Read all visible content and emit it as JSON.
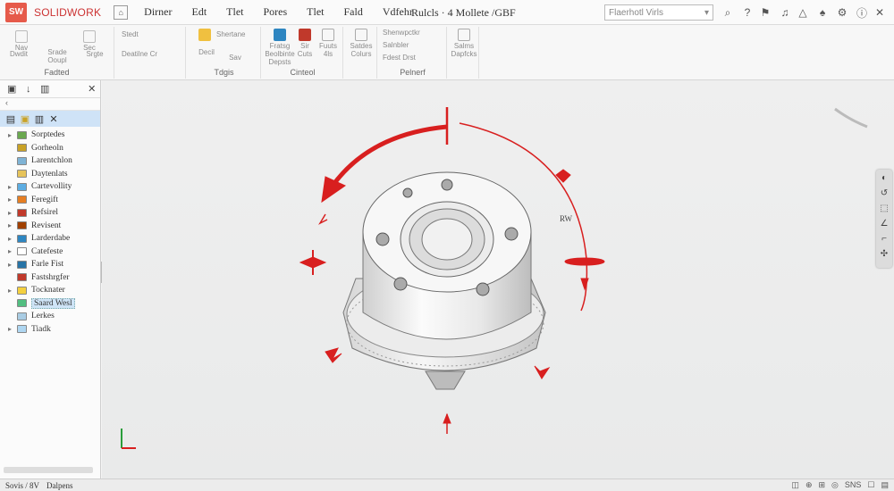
{
  "app": {
    "logo": "SW",
    "brand": "SOLIDWORK",
    "home_icon": "home-icon",
    "menus": [
      "Dirner",
      "Edt",
      "Tlet",
      "Pores",
      "Tlet",
      "Fald",
      "Vdfehr"
    ],
    "doc_title": "Rulcls · 4 Mollete /GBF",
    "search_placeholder": "Flaerhotl Virls"
  },
  "ribbon": {
    "groups": [
      {
        "label": "Fadted",
        "buttons": [
          "Nav",
          "Sec",
          "Dwdit",
          "Srade Ooupl",
          "Srgte"
        ]
      },
      {
        "label": "",
        "buttons": [
          "Stedt",
          "Deatilne Cr"
        ]
      },
      {
        "label": "Tdgis",
        "buttons": [
          "Shertane",
          "Decil",
          "Sav"
        ]
      },
      {
        "label": "Cinteol",
        "buttons": [
          "Fratsg Beolbinte Depsts",
          "Sir Cuts",
          "Fuuts 4ls"
        ]
      },
      {
        "label": "",
        "buttons": [
          "Satdes Colurs"
        ]
      },
      {
        "label": "Pelnerf",
        "buttons": [
          "Shenwpctkr",
          "Salnbler",
          "Fdest Drst"
        ]
      },
      {
        "label": "",
        "buttons": [
          "Salms Dapfcks"
        ]
      }
    ]
  },
  "feature_tree": {
    "tabs": [
      "▣",
      "↓",
      "▥",
      "✕"
    ],
    "filter": "‹",
    "nodes": [
      {
        "label": "Sorptedes",
        "color": "#6aa84f",
        "expander": "▸"
      },
      {
        "label": "Gorheoln",
        "color": "#c9a227",
        "expander": ""
      },
      {
        "label": "Larentchlon",
        "color": "#7fb3d5",
        "expander": ""
      },
      {
        "label": "Daytenlats",
        "color": "#e6c35a",
        "expander": ""
      },
      {
        "label": "Cartevollity",
        "color": "#5dade2",
        "expander": "▸"
      },
      {
        "label": "Feregift",
        "color": "#e67e22",
        "expander": "▸"
      },
      {
        "label": "Refsirel",
        "color": "#c0392b",
        "expander": "▸"
      },
      {
        "label": "Revisent",
        "color": "#a04000",
        "expander": "▸"
      },
      {
        "label": "Larderdabe",
        "color": "#2e86c1",
        "expander": "▸"
      },
      {
        "label": "Catefeste",
        "color": "#ffffff",
        "expander": "▸"
      },
      {
        "label": "Farle Fist",
        "color": "#2874a6",
        "expander": "▸"
      },
      {
        "label": "Fastshrgfer",
        "color": "#c0392b",
        "expander": ""
      },
      {
        "label": "Tocknater",
        "color": "#f4d03f",
        "expander": "▸"
      },
      {
        "label": "Saard Wesl",
        "color": "#52be80",
        "expander": "",
        "selected": true
      },
      {
        "label": "Lerkes",
        "color": "#a9cce3",
        "expander": ""
      },
      {
        "label": "Tiadk",
        "color": "#aed6f1",
        "expander": "▸"
      }
    ]
  },
  "viewport": {
    "rw_label": "RW",
    "right_toolbar": [
      "◐",
      "↺",
      "⬚",
      "∠",
      "⌐",
      "✣",
      "⌂"
    ]
  },
  "status": {
    "left": "Sovis / 8V",
    "sheet": "Dalpens",
    "right": [
      "◫",
      "⊕",
      "⊞",
      "◎",
      "☐",
      "☐",
      "▤"
    ],
    "right_label": "SNS"
  },
  "colors": {
    "accent_red": "#d81f1f",
    "selection": "#cfe4f7"
  }
}
